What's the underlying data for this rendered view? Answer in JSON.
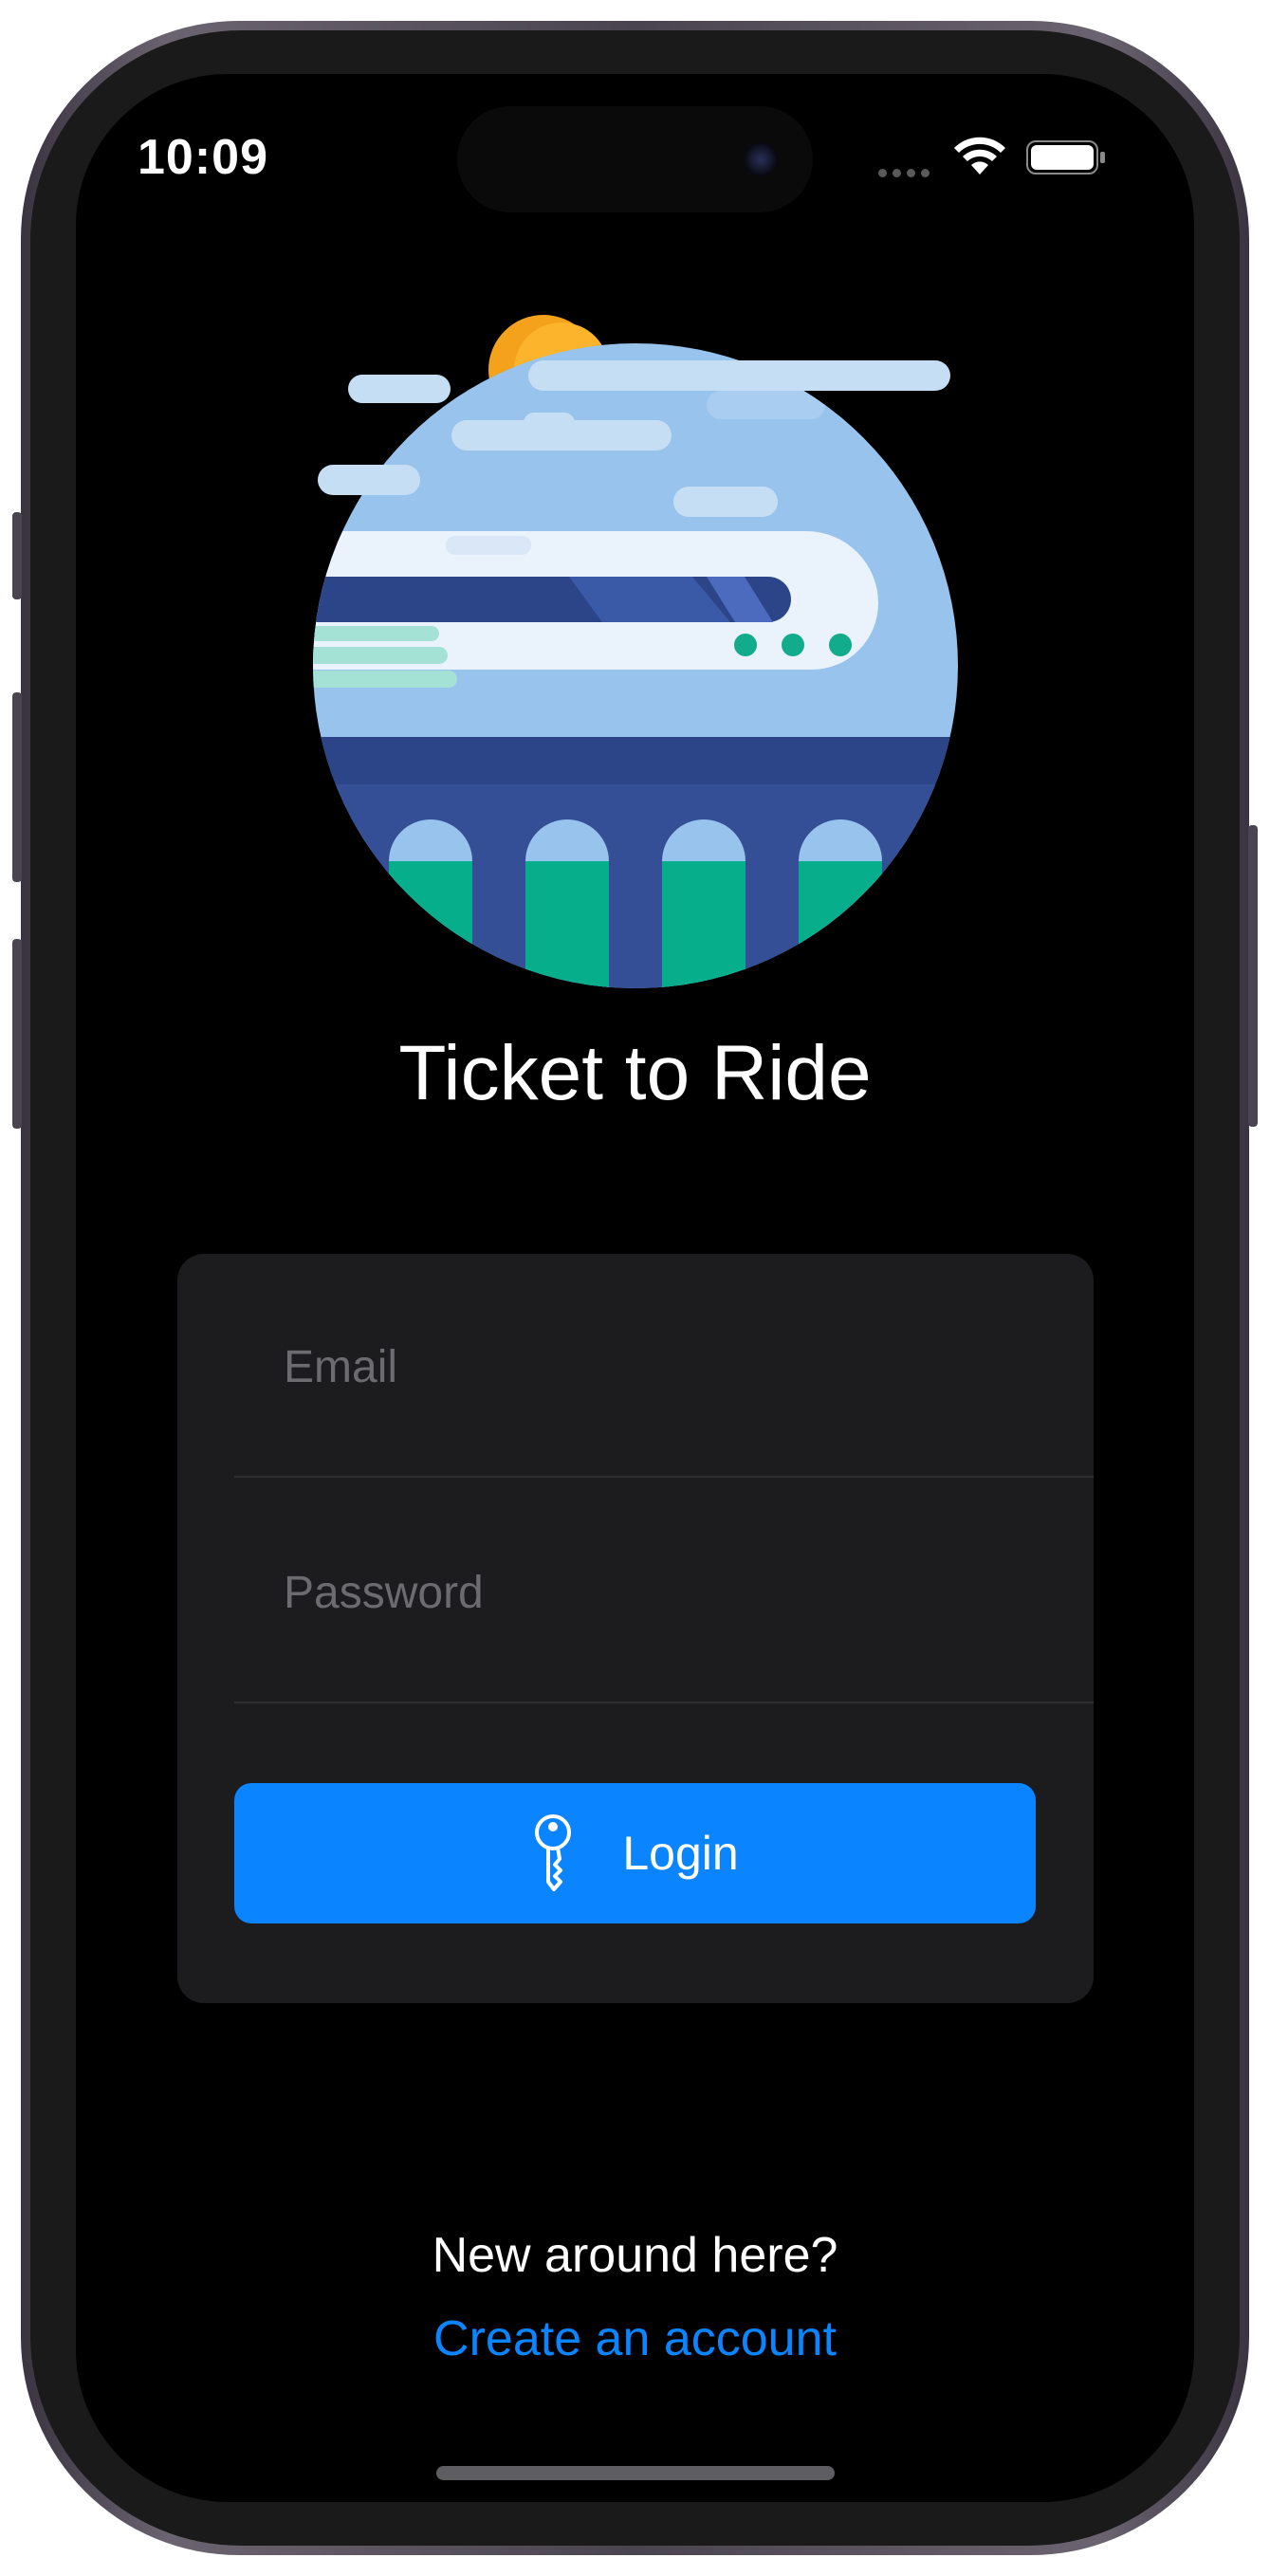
{
  "status_bar": {
    "time": "10:09",
    "icons": [
      "cellular-signal-icon",
      "wifi-icon",
      "battery-icon"
    ]
  },
  "hero": {
    "icon": "train-on-bridge-illustration"
  },
  "app": {
    "title": "Ticket to Ride"
  },
  "login_form": {
    "email_placeholder": "Email",
    "email_value": "",
    "password_placeholder": "Password",
    "password_value": "",
    "login_button_label": "Login",
    "login_button_icon": "key-icon"
  },
  "signup": {
    "prompt": "New around here?",
    "link_label": "Create an account"
  },
  "colors": {
    "accent": "#0a84ff",
    "background": "#000000",
    "card": "#1c1c1e"
  }
}
